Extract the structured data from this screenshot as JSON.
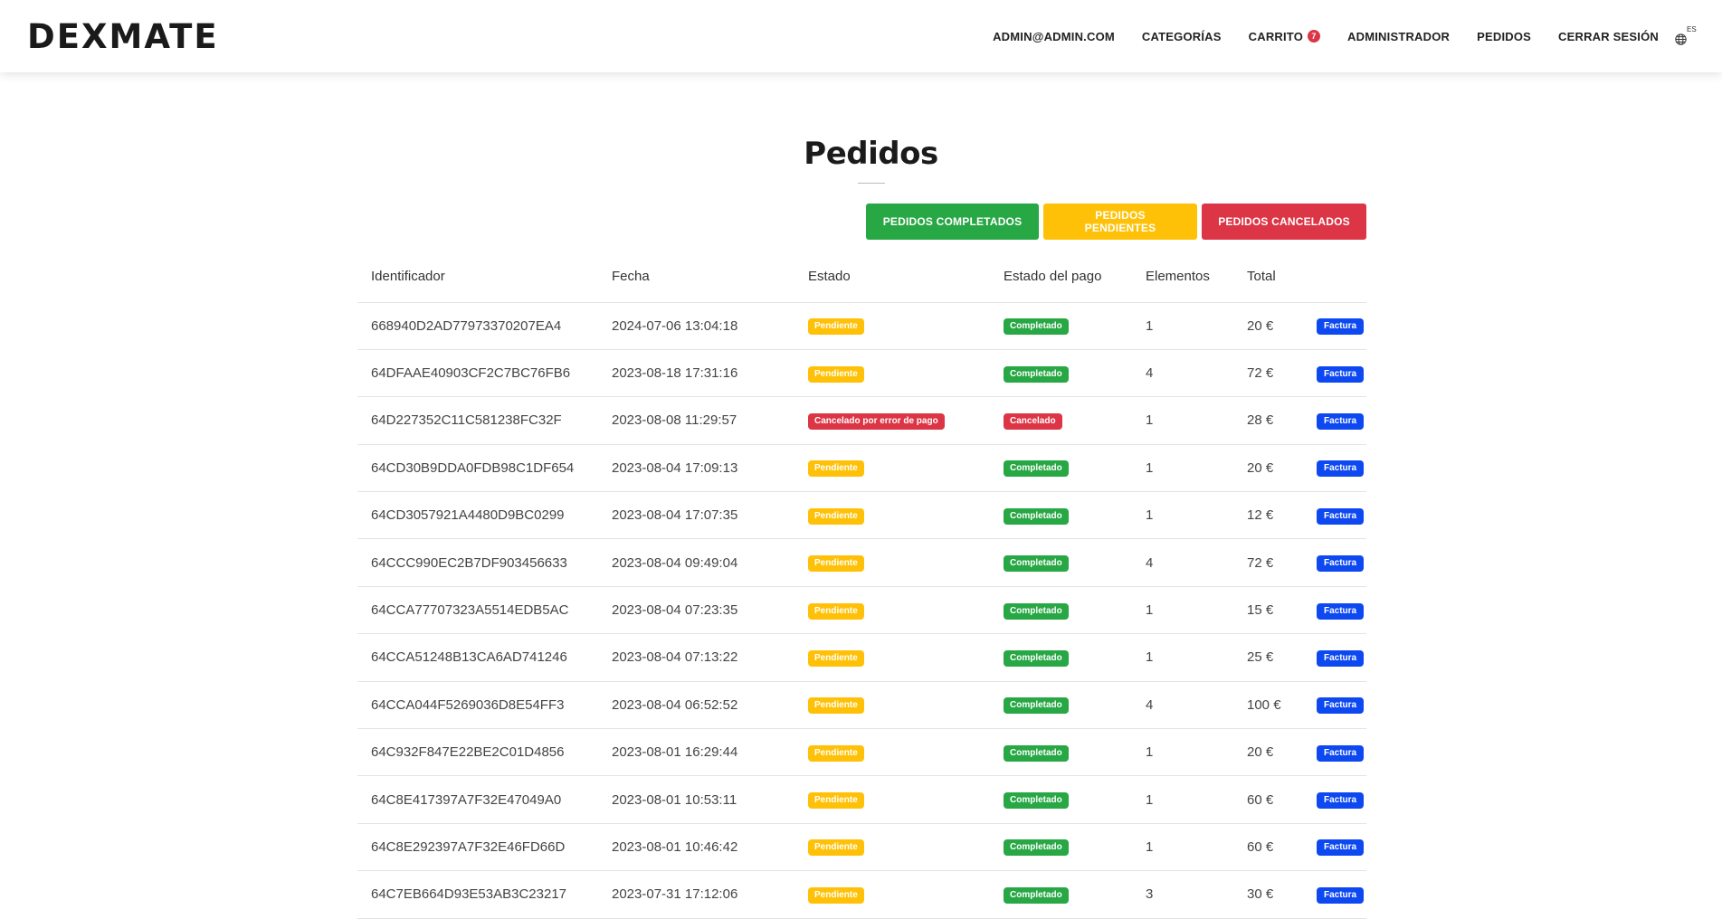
{
  "brand": "DEXMATE",
  "nav": {
    "items": [
      {
        "label": "ADMIN@ADMIN.COM",
        "name": "nav-user"
      },
      {
        "label": "CATEGORÍAS",
        "name": "nav-categories"
      },
      {
        "label": "CARRITO",
        "name": "nav-cart"
      },
      {
        "label": "ADMINISTRADOR",
        "name": "nav-admin"
      },
      {
        "label": "PEDIDOS",
        "name": "nav-orders"
      },
      {
        "label": "CERRAR SESIÓN",
        "name": "nav-logout"
      }
    ],
    "cart_count": "7",
    "lang_code": "ES",
    "lang_icon": "globe-icon"
  },
  "page": {
    "title": "Pedidos"
  },
  "filters": {
    "completed": "PEDIDOS COMPLETADOS",
    "pending": "PEDIDOS PENDIENTES",
    "cancelled": "PEDIDOS CANCELADOS"
  },
  "table": {
    "headers": [
      "Identificador",
      "Fecha",
      "Estado",
      "Estado del pago",
      "Elementos",
      "Total",
      ""
    ],
    "invoice_label": "Factura",
    "rows": [
      {
        "id": "668940D2AD77973370207EA4",
        "date": "2024-07-06 13:04:18",
        "status": "Pendiente",
        "status_kind": "pending",
        "payment": "Completado",
        "payment_kind": "done",
        "items": "1",
        "total": "20 €"
      },
      {
        "id": "64DFAAE40903CF2C7BC76FB6",
        "date": "2023-08-18 17:31:16",
        "status": "Pendiente",
        "status_kind": "pending",
        "payment": "Completado",
        "payment_kind": "done",
        "items": "4",
        "total": "72 €"
      },
      {
        "id": "64D227352C11C581238FC32F",
        "date": "2023-08-08 11:29:57",
        "status": "Cancelado por error de pago",
        "status_kind": "cancel",
        "payment": "Cancelado",
        "payment_kind": "cancel",
        "items": "1",
        "total": "28 €"
      },
      {
        "id": "64CD30B9DDA0FDB98C1DF654",
        "date": "2023-08-04 17:09:13",
        "status": "Pendiente",
        "status_kind": "pending",
        "payment": "Completado",
        "payment_kind": "done",
        "items": "1",
        "total": "20 €"
      },
      {
        "id": "64CD3057921A4480D9BC0299",
        "date": "2023-08-04 17:07:35",
        "status": "Pendiente",
        "status_kind": "pending",
        "payment": "Completado",
        "payment_kind": "done",
        "items": "1",
        "total": "12 €"
      },
      {
        "id": "64CCC990EC2B7DF903456633",
        "date": "2023-08-04 09:49:04",
        "status": "Pendiente",
        "status_kind": "pending",
        "payment": "Completado",
        "payment_kind": "done",
        "items": "4",
        "total": "72 €"
      },
      {
        "id": "64CCA77707323A5514EDB5AC",
        "date": "2023-08-04 07:23:35",
        "status": "Pendiente",
        "status_kind": "pending",
        "payment": "Completado",
        "payment_kind": "done",
        "items": "1",
        "total": "15 €"
      },
      {
        "id": "64CCA51248B13CA6AD741246",
        "date": "2023-08-04 07:13:22",
        "status": "Pendiente",
        "status_kind": "pending",
        "payment": "Completado",
        "payment_kind": "done",
        "items": "1",
        "total": "25 €"
      },
      {
        "id": "64CCA044F5269036D8E54FF3",
        "date": "2023-08-04 06:52:52",
        "status": "Pendiente",
        "status_kind": "pending",
        "payment": "Completado",
        "payment_kind": "done",
        "items": "4",
        "total": "100 €"
      },
      {
        "id": "64C932F847E22BE2C01D4856",
        "date": "2023-08-01 16:29:44",
        "status": "Pendiente",
        "status_kind": "pending",
        "payment": "Completado",
        "payment_kind": "done",
        "items": "1",
        "total": "20 €"
      },
      {
        "id": "64C8E417397A7F32E47049A0",
        "date": "2023-08-01 10:53:11",
        "status": "Pendiente",
        "status_kind": "pending",
        "payment": "Completado",
        "payment_kind": "done",
        "items": "1",
        "total": "60 €"
      },
      {
        "id": "64C8E292397A7F32E46FD66D",
        "date": "2023-08-01 10:46:42",
        "status": "Pendiente",
        "status_kind": "pending",
        "payment": "Completado",
        "payment_kind": "done",
        "items": "1",
        "total": "60 €"
      },
      {
        "id": "64C7EB664D93E53AB3C23217",
        "date": "2023-07-31 17:12:06",
        "status": "Pendiente",
        "status_kind": "pending",
        "payment": "Completado",
        "payment_kind": "done",
        "items": "3",
        "total": "30 €"
      }
    ]
  },
  "colors": {
    "pending": "#ffc107",
    "cancel": "#dc3545",
    "done": "#28a745",
    "invoice": "#0d48f0"
  }
}
